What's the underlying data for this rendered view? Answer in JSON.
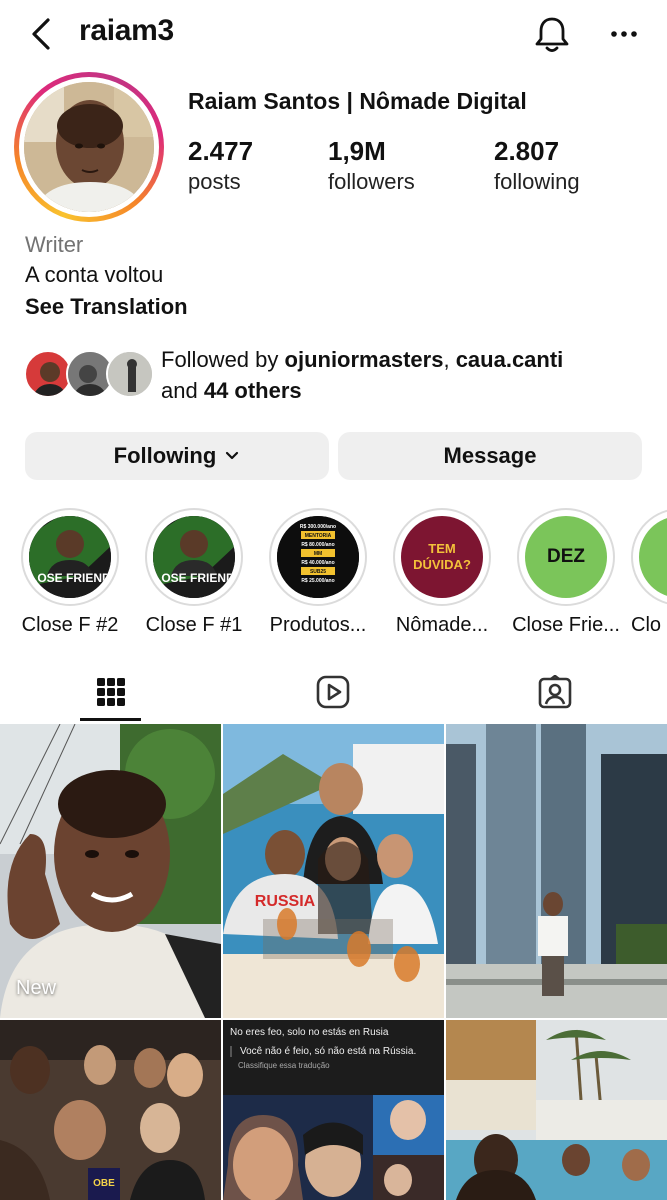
{
  "header": {
    "username": "raiam3"
  },
  "profile": {
    "display_name": "Raiam Santos | Nômade Digital",
    "stats": [
      {
        "value": "2.477",
        "label": "posts"
      },
      {
        "value": "1,9M",
        "label": "followers"
      },
      {
        "value": "2.807",
        "label": "following"
      }
    ],
    "category": "Writer",
    "bio": "A conta voltou",
    "see_translation": "See Translation"
  },
  "followed_by": {
    "prefix": "Followed by ",
    "user1": "ojuniormasters",
    "separator": ", ",
    "user2": "caua.canti",
    "and_text": "and ",
    "others": "44 others"
  },
  "actions": {
    "following_label": "Following",
    "message_label": "Message"
  },
  "highlights": [
    {
      "label": "Close F #2",
      "cover_text": "CLOSE FRIENDS"
    },
    {
      "label": "Close F #1",
      "cover_text": "CLOSE FRIENDS"
    },
    {
      "label": "Produtos...",
      "cover_lines": [
        "R$ 300.000/ano",
        "MENTORIA",
        "R$ 80.000/ano",
        "MM",
        "R$ 40.000/ano",
        "SUB25",
        "R$ 25.000/ano"
      ]
    },
    {
      "label": "Nômade...",
      "cover_text": "TEM DÚVIDA?"
    },
    {
      "label": "Close Frie...",
      "cover_text": "DEZ"
    },
    {
      "label": "Clo",
      "cover_text": ""
    }
  ],
  "tabs": {
    "grid": "grid-icon",
    "reels": "reels-icon",
    "tagged": "tagged-icon"
  },
  "posts": {
    "first_badge": "New",
    "shirt_text": "RUSSIA",
    "quote_es": "No eres feo, solo no estás en Rusia",
    "quote_pt": "Você não é feio, só não está na Rússia.",
    "quote_translate": "Classifique essa tradução",
    "can_text": "OBE"
  },
  "colors": {
    "accent_ring_start": "#f9c22e",
    "accent_ring_end": "#c13584",
    "button_bg": "#efefef",
    "muted_text": "#737373"
  }
}
